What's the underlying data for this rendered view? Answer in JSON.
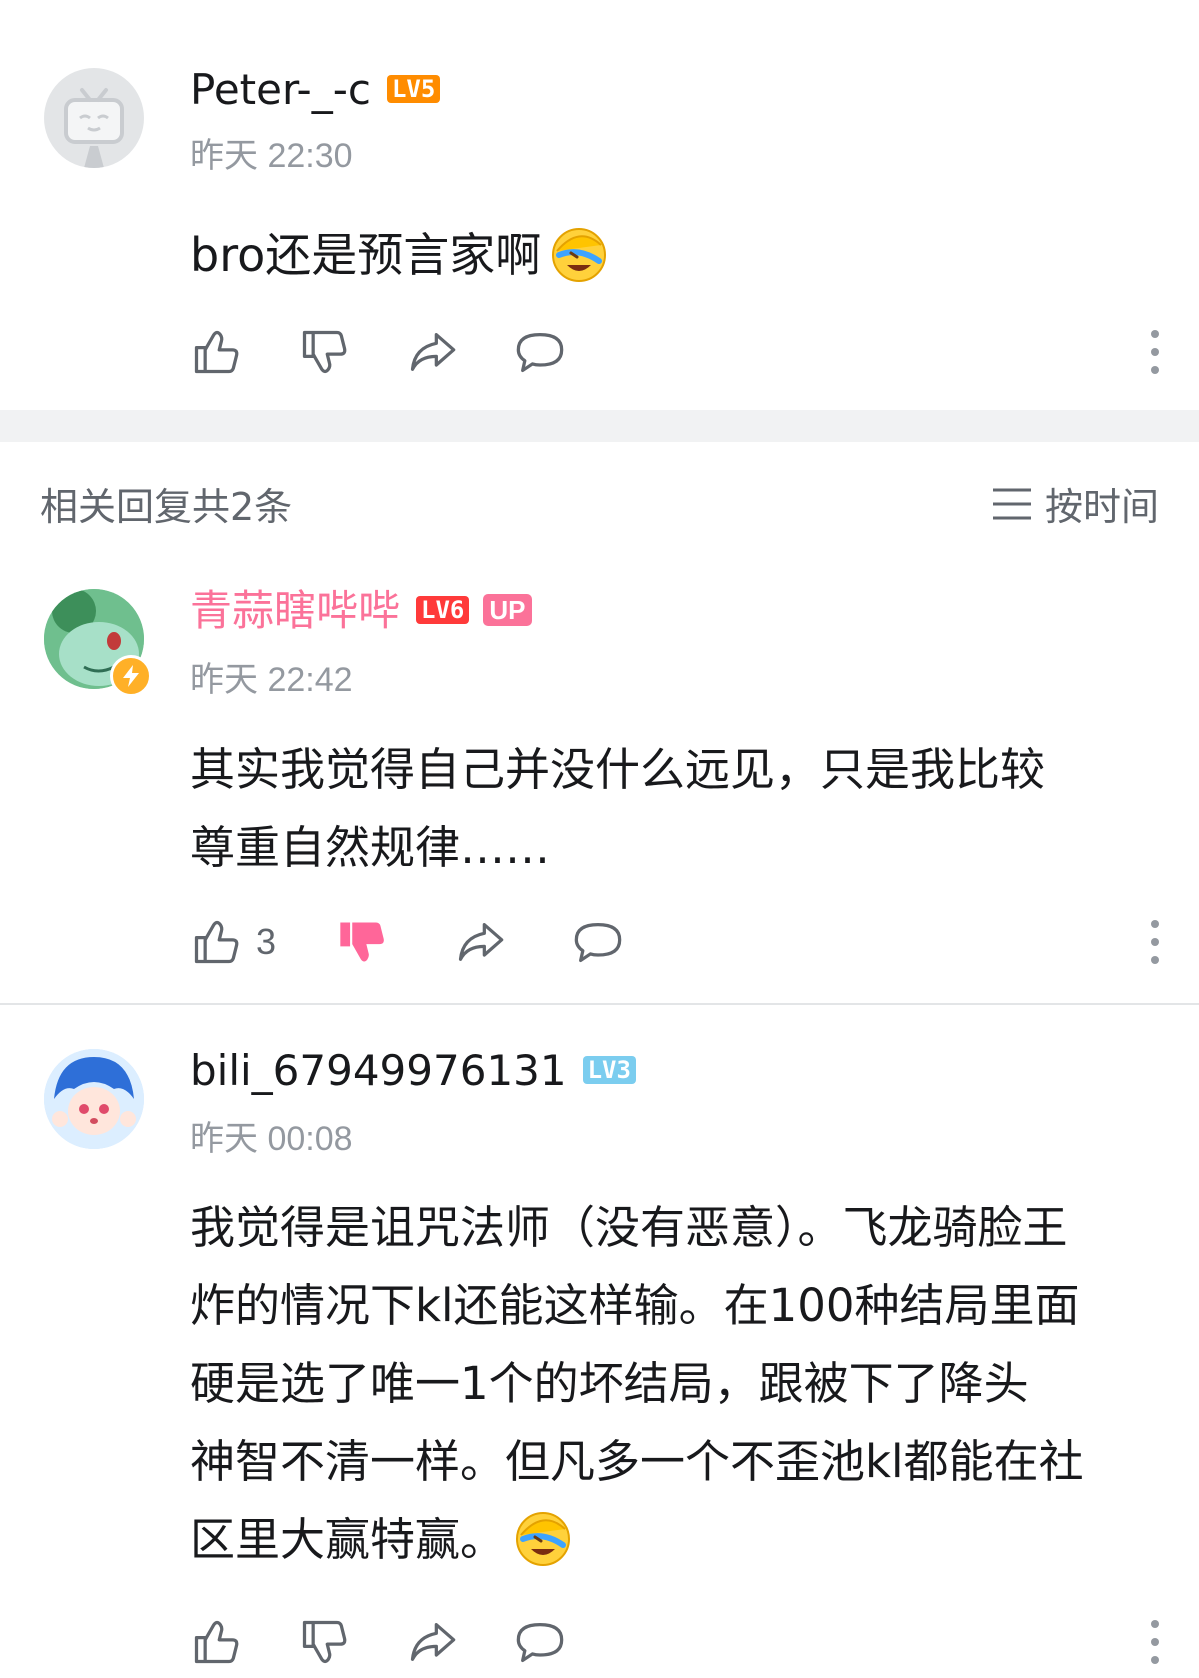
{
  "main_comment": {
    "username": "Peter-_-c",
    "level": "LV5",
    "time": "昨天 22:30",
    "text": "bro还是预言家啊",
    "emoji": "laughing-cry-emoji"
  },
  "replies_header": {
    "title": "相关回复共2条",
    "sort_label": "按时间",
    "sort_icon": "list-icon"
  },
  "replies": [
    {
      "username": "青蒜瞎哔哔",
      "level": "LV6",
      "up_badge": "UP",
      "time": "昨天 22:42",
      "text_line1": "其实我觉得自己并没什么远见，只是我比较",
      "text_line2": "尊重自然规律……",
      "like_count": "3",
      "disliked": true
    },
    {
      "username": "bili_67949976131",
      "level": "LV3",
      "time": "昨天 00:08",
      "text_line1": "我觉得是诅咒法师（没有恶意）。飞龙骑脸王",
      "text_line2": "炸的情况下kl还能这样输。在100种结局里面",
      "text_line3": "硬是选了唯一1个的坏结局，跟被下了降头",
      "text_line4": "神智不清一样。但凡多一个不歪池kl都能在社",
      "text_line5": "区里大赢特赢。"
    }
  ],
  "colors": {
    "pink_name": "#fb7299",
    "gray_text": "#9499a0",
    "dislike_active": "#ff6699",
    "icon_gray": "#61666d"
  }
}
